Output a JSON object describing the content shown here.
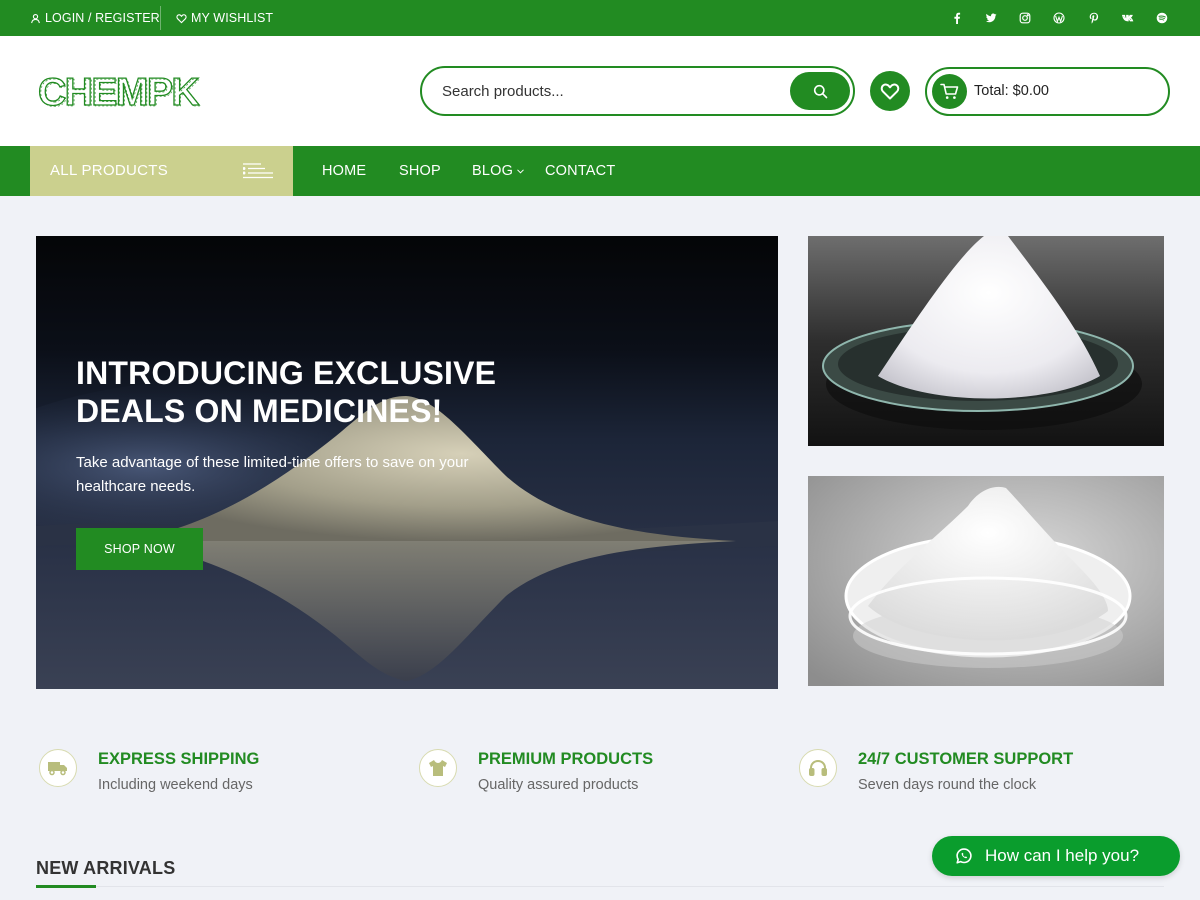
{
  "topbar": {
    "login_label": "LOGIN / REGISTER",
    "wishlist_label": "MY WISHLIST",
    "social_icons": [
      "facebook-icon",
      "twitter-icon",
      "instagram-icon",
      "wordpress-icon",
      "pinterest-icon",
      "vk-icon",
      "spotify-icon"
    ]
  },
  "header": {
    "logo_text": "CHEMPK",
    "search_placeholder": "Search products...",
    "cart_total": "Total: $0.00"
  },
  "nav": {
    "all_products_label": "ALL PRODUCTS",
    "items": [
      "HOME",
      "SHOP",
      "BLOG",
      "CONTACT"
    ]
  },
  "hero": {
    "title_line1": "INTRODUCING EXCLUSIVE",
    "title_line2": "DEALS ON MEDICINES!",
    "text": "Take advantage of these limited-time offers to save on your healthcare needs.",
    "button_label": "SHOP NOW"
  },
  "features": [
    {
      "title": "EXPRESS SHIPPING",
      "subtitle": "Including weekend days",
      "icon": "truck-icon"
    },
    {
      "title": "PREMIUM PRODUCTS",
      "subtitle": "Quality assured products",
      "icon": "tshirt-icon"
    },
    {
      "title": "24/7 CUSTOMER SUPPORT",
      "subtitle": "Seven days round the clock",
      "icon": "headset-icon"
    }
  ],
  "section": {
    "new_arrivals_title": "NEW ARRIVALS"
  },
  "chat": {
    "label": "How can I help you?"
  },
  "colors": {
    "brand_green": "#228b22",
    "all_products_bg": "#cbd08e",
    "chat_green": "#0a9d2d",
    "page_bg": "#f0f2f7"
  }
}
